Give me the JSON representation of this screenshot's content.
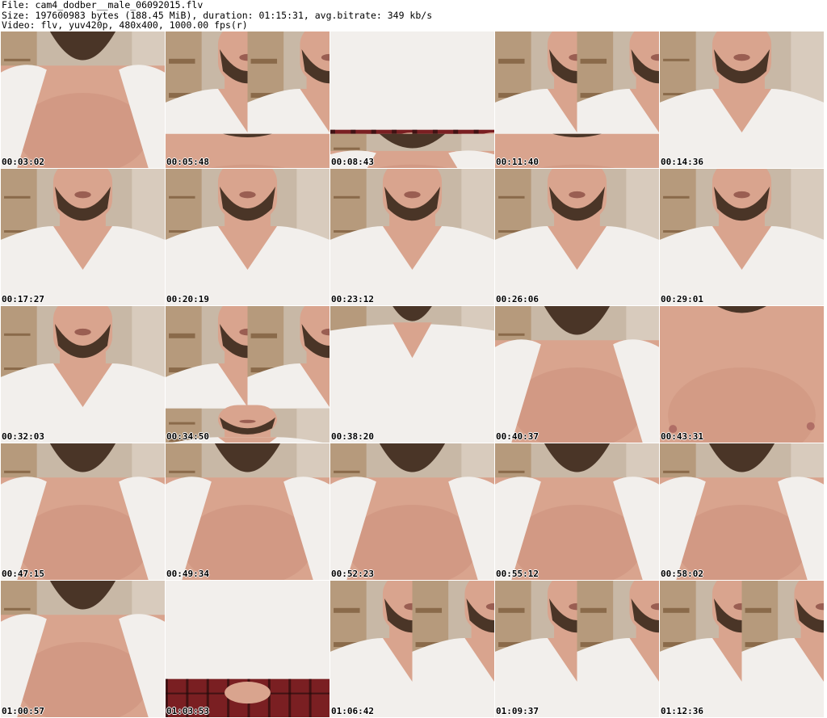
{
  "header": {
    "file_line": "File: cam4_dodber__male_06092015.flv",
    "size_line": "Size: 197600983 bytes (188.45 MiB), duration: 01:15:31, avg.bitrate: 349 kb/s",
    "video_line": "Video: flv, yuv420p, 480x400, 1000.00 fps(r)"
  },
  "thumbnails": [
    {
      "timestamp": "00:03:02",
      "scene": "open-shirt-chest"
    },
    {
      "timestamp": "00:05:48",
      "scene": "split-tshirt-chest"
    },
    {
      "timestamp": "00:08:43",
      "scene": "split-shorts-chest"
    },
    {
      "timestamp": "00:11:40",
      "scene": "split-tshirt-chest"
    },
    {
      "timestamp": "00:14:36",
      "scene": "vneck-face"
    },
    {
      "timestamp": "00:17:27",
      "scene": "vneck-face"
    },
    {
      "timestamp": "00:20:19",
      "scene": "vneck-face"
    },
    {
      "timestamp": "00:23:12",
      "scene": "vneck-face"
    },
    {
      "timestamp": "00:26:06",
      "scene": "vneck-face"
    },
    {
      "timestamp": "00:29:01",
      "scene": "vneck-face"
    },
    {
      "timestamp": "00:32:03",
      "scene": "vneck-face"
    },
    {
      "timestamp": "00:34:50",
      "scene": "split-vneck"
    },
    {
      "timestamp": "00:38:20",
      "scene": "vneck-torso"
    },
    {
      "timestamp": "00:40:37",
      "scene": "open-shirt-chest"
    },
    {
      "timestamp": "00:43:31",
      "scene": "bare-chest"
    },
    {
      "timestamp": "00:47:15",
      "scene": "open-shirt-chest"
    },
    {
      "timestamp": "00:49:34",
      "scene": "open-shirt-chest"
    },
    {
      "timestamp": "00:52:23",
      "scene": "open-shirt-chest"
    },
    {
      "timestamp": "00:55:12",
      "scene": "open-shirt-chest"
    },
    {
      "timestamp": "00:58:02",
      "scene": "open-shirt-chest"
    },
    {
      "timestamp": "01:00:57",
      "scene": "open-shirt-chest"
    },
    {
      "timestamp": "01:03:53",
      "scene": "tshirt-shorts"
    },
    {
      "timestamp": "01:06:42",
      "scene": "split-shorts-vneck"
    },
    {
      "timestamp": "01:09:37",
      "scene": "split-shorts-vneck"
    },
    {
      "timestamp": "01:12:36",
      "scene": "split-shorts-vneck"
    }
  ],
  "colors": {
    "skin": "#d9a48e",
    "skin_dark": "#c78872",
    "beard": "#4a3527",
    "shirt": "#f2efec",
    "wall": "#c8b8a6",
    "shelf": "#8a6a4a",
    "plaid": "#7a1f22",
    "timestamp_text": "#000000"
  }
}
